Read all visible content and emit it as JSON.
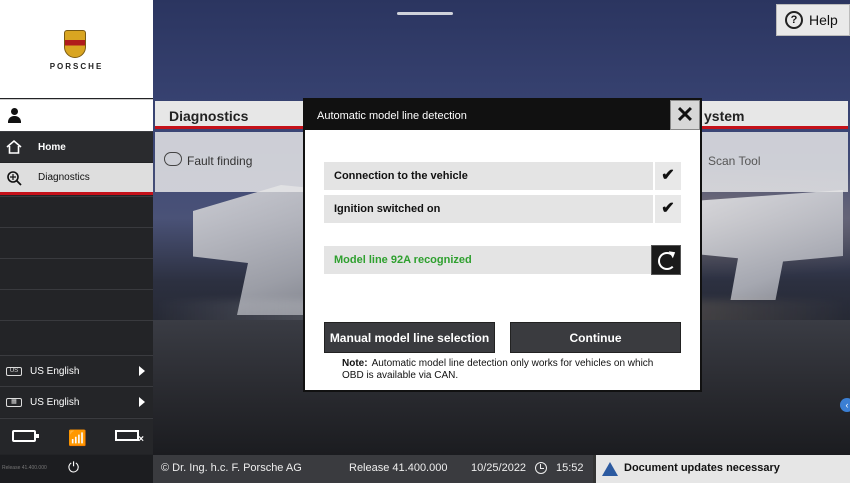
{
  "sidebar": {
    "brand": "PORSCHE",
    "nav": {
      "home": "Home",
      "diagnostics": "Diagnostics"
    },
    "languages": [
      {
        "icon": "US",
        "label": "US English"
      },
      {
        "icon": "keyboard",
        "label": "US English"
      }
    ],
    "release_small": "Release 41.400.000"
  },
  "help": {
    "label": "Help"
  },
  "tiles": {
    "diagnostics": {
      "title": "Diagnostics",
      "item": "Fault finding"
    },
    "system": {
      "title": "ystem",
      "item": "Scan Tool"
    }
  },
  "dialog": {
    "title": "Automatic model line detection",
    "close": "✕",
    "checks": [
      {
        "label": "Connection to the vehicle",
        "mark": "✔"
      },
      {
        "label": "Ignition switched on",
        "mark": "✔"
      }
    ],
    "model_line": "Model line 92A recognized",
    "buttons": {
      "manual": "Manual model line selection",
      "continue": "Continue"
    },
    "note_label": "Note:",
    "note_text": "Automatic model line detection only works for vehicles on which OBD is available via CAN."
  },
  "footer": {
    "copyright": "© Dr. Ing. h.c. F. Porsche AG",
    "release": "Release 41.400.000",
    "date": "10/25/2022",
    "time": "15:52",
    "doc_updates": "Document updates necessary"
  },
  "colors": {
    "accent_red": "#c4111a",
    "success_green": "#2fa02f",
    "warning_blue": "#2c5aa0"
  }
}
